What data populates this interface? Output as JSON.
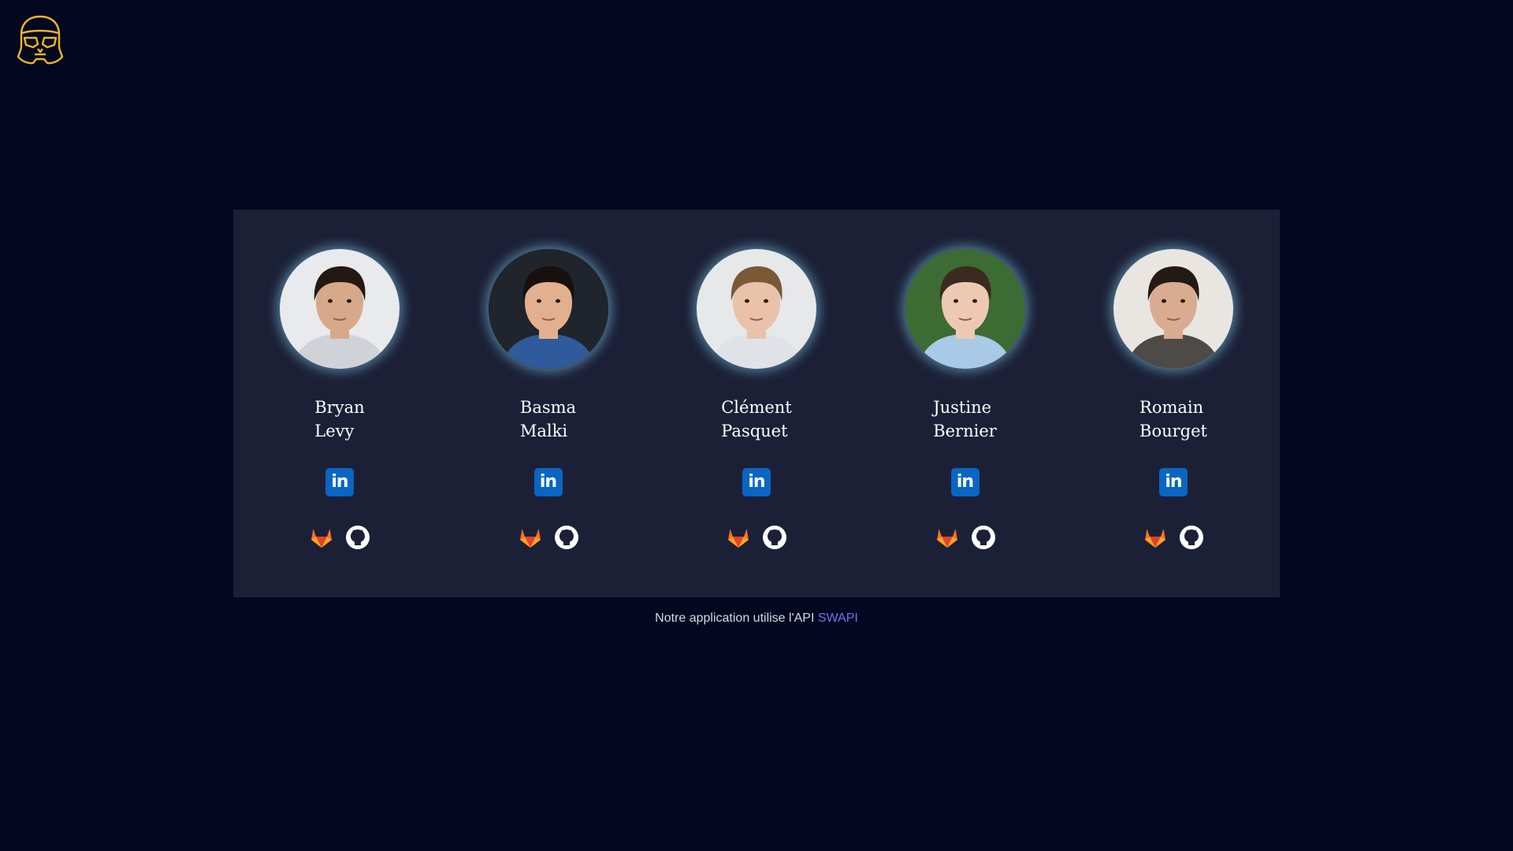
{
  "logo": {
    "icon": "stormtrooper-helmet-icon",
    "color": "#e8b82a"
  },
  "team": [
    {
      "first": "Bryan",
      "last": "Levy",
      "skin": "#d7a98a",
      "hair": "#241912",
      "bg": "#e8eaee",
      "shirt": "#cfd3d8"
    },
    {
      "first": "Basma",
      "last": "Malki",
      "skin": "#e3b08f",
      "hair": "#17100c",
      "bg": "#20242c",
      "shirt": "#2f5a9c"
    },
    {
      "first": "Clément",
      "last": "Pasquet",
      "skin": "#e9c2a9",
      "hair": "#7b5836",
      "bg": "#e7e8ea",
      "shirt": "#dfe3e8"
    },
    {
      "first": "Justine",
      "last": "Bernier",
      "skin": "#edc9b4",
      "hair": "#3b2a20",
      "bg": "#3c6b34",
      "shirt": "#a9c9e6"
    },
    {
      "first": "Romain",
      "last": "Bourget",
      "skin": "#d9ab90",
      "hair": "#241a15",
      "bg": "#e9e6e1",
      "shirt": "#4e4a47"
    }
  ],
  "icons": {
    "linkedin": "in",
    "gitlab": "gitlab-icon",
    "github": "github-icon"
  },
  "colors": {
    "linkedin": "#0a66c2",
    "gitlab_a": "#e24329",
    "gitlab_b": "#fc6d26",
    "gitlab_c": "#fca326",
    "link": "#6f76f0"
  },
  "footer": {
    "text": "Notre application utilise l'API ",
    "link": "SWAPI"
  }
}
